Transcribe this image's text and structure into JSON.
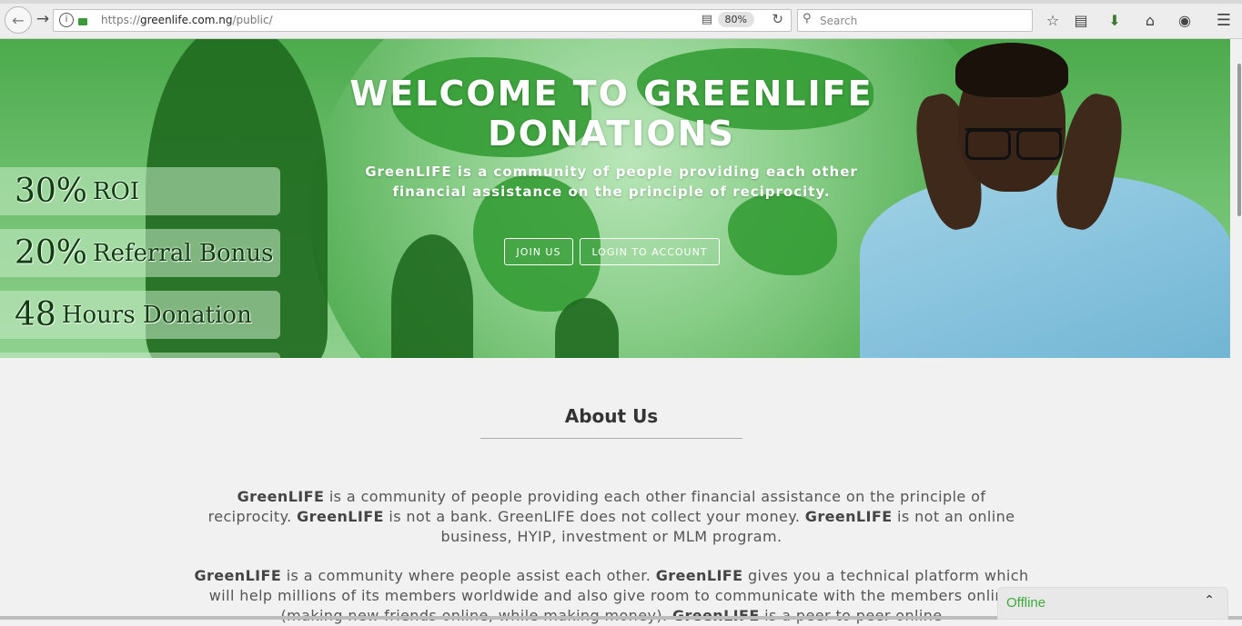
{
  "browser": {
    "url_secure": "https://",
    "url_host": "greenlife.com.ng",
    "url_path": "/public/",
    "zoom": "80%",
    "search_placeholder": "Search"
  },
  "hero": {
    "banners": [
      {
        "num": "30%",
        "text": "ROI"
      },
      {
        "num": "20%",
        "text": "Referral Bonus"
      },
      {
        "num": "48",
        "text": "Hours Donation"
      }
    ],
    "title": "WELCOME TO GREENLIFE DONATIONS",
    "subtitle": "GreenLIFE is a community of people providing each other financial assistance on the principle of reciprocity.",
    "join_label": "JOIN US",
    "login_label": "LOGIN TO ACCOUNT"
  },
  "about": {
    "title": "About Us",
    "brand": "GreenLIFE",
    "p1_a": " is a community of people providing each other financial assistance on the principle of reciprocity. ",
    "p1_b": " is not a bank. GreenLIFE does not collect your money. ",
    "p1_c": " is not an online business, HYIP, investment or MLM program.",
    "p2_a": " is a community where people assist each other. ",
    "p2_b": " gives you a technical platform which will help millions of its members worldwide and also give room to communicate with the members online (making new friends online, while making money). ",
    "p2_c": " is a peer to peer online"
  },
  "chat": {
    "label": "Offline"
  },
  "colors": {
    "accent_green": "#3cab3c",
    "hero_green": "#4caa4c"
  }
}
